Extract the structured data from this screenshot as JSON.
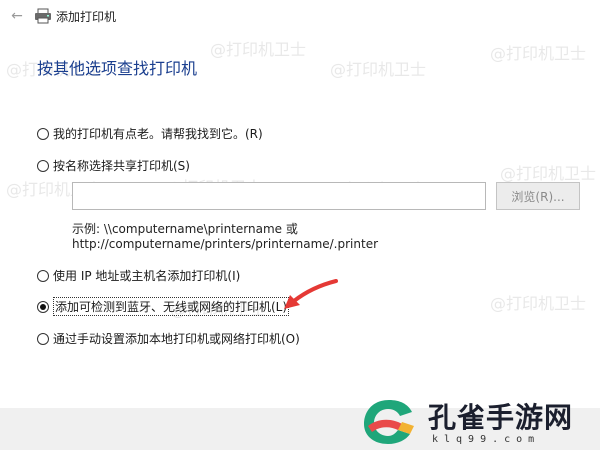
{
  "window": {
    "title": "添加打印机",
    "back_glyph": "←"
  },
  "heading": "按其他选项查找打印机",
  "options": [
    {
      "label": "我的打印机有点老。请帮我找到它。(R)",
      "checked": false
    },
    {
      "label": "按名称选择共享打印机(S)",
      "checked": false
    },
    {
      "label": "使用 IP 地址或主机名添加打印机(I)",
      "checked": false
    },
    {
      "label": "添加可检测到蓝牙、无线或网络的打印机(L)",
      "checked": true
    },
    {
      "label": "通过手动设置添加本地打印机或网络打印机(O)",
      "checked": false
    }
  ],
  "shared_printer": {
    "value": "",
    "browse_label": "浏览(R)...",
    "example_line1": "示例: \\\\computername\\printername 或",
    "example_line2": "http://computername/printers/printername/.printer"
  },
  "watermark_text": "@打印机卫士",
  "logo": {
    "name": "孔雀手游网",
    "url": "klq99.com"
  },
  "colors": {
    "heading": "#1b3f8f",
    "annotation_arrow": "#e53935",
    "footer": "#f0f0f0"
  },
  "icons": {
    "back": "arrow-left-icon",
    "printer": "printer-icon"
  }
}
